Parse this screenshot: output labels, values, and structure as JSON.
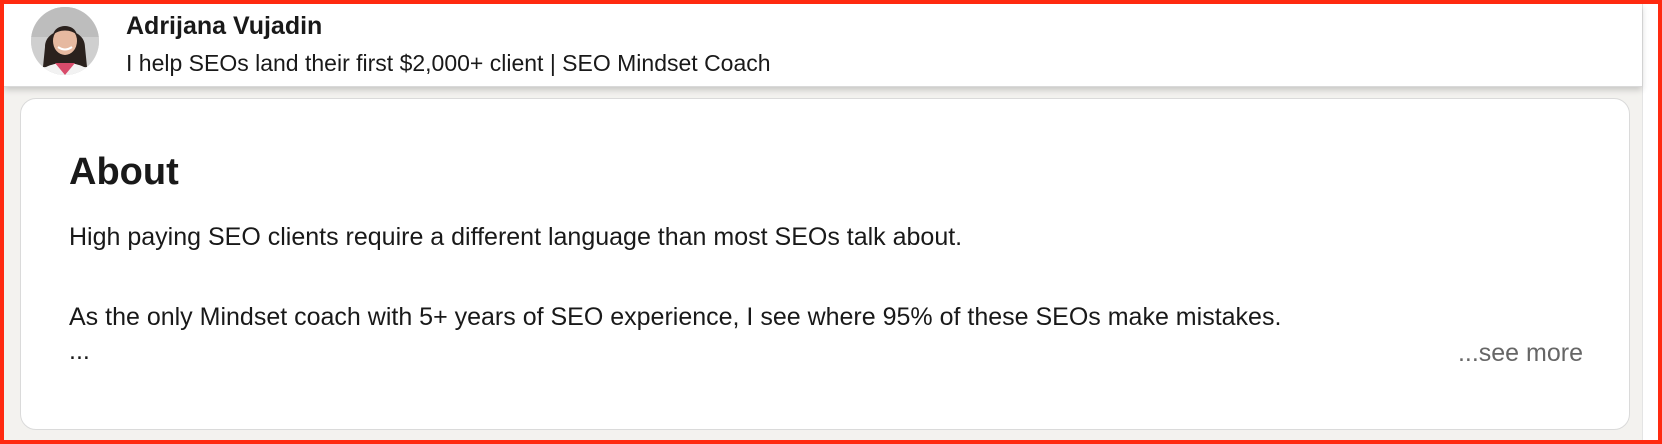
{
  "header": {
    "profile_name": "Adrijana Vujadin",
    "headline": "I help SEOs land their first $2,000+ client | SEO Mindset Coach",
    "avatar_icon": "profile-photo"
  },
  "about": {
    "title": "About",
    "paragraphs": [
      "High paying SEO clients require a different language than most SEOs talk about.",
      "As the only Mindset coach with 5+ years of SEO experience, I see where 95% of these SEOs make mistakes."
    ],
    "truncation": "...",
    "see_more_label": "...see more"
  },
  "colors": {
    "highlight_border": "#ff2a10",
    "text_primary": "#191919",
    "text_secondary": "#666666",
    "page_background": "#f3f2ef"
  }
}
